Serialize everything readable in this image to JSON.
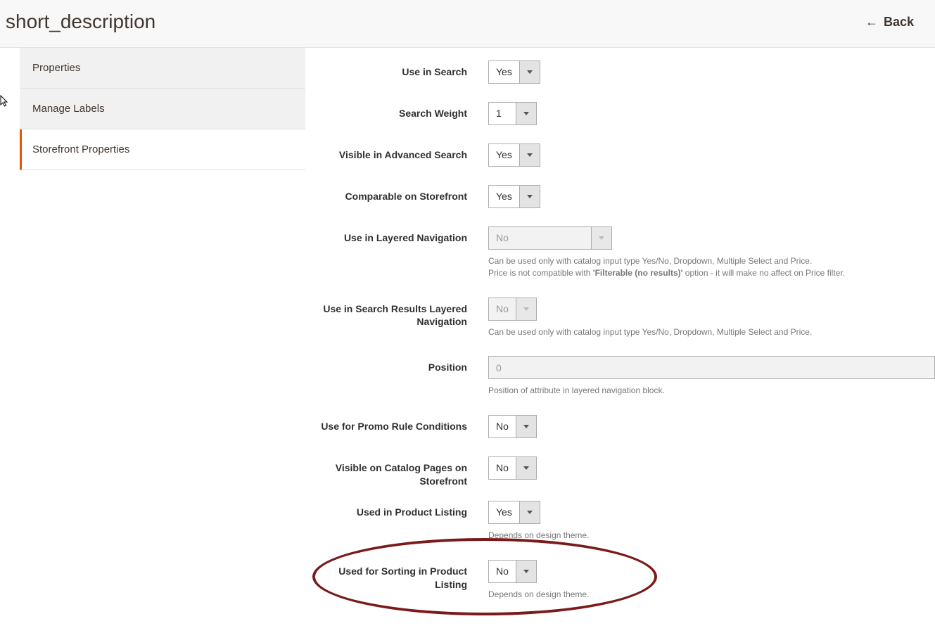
{
  "header": {
    "title": "short_description",
    "back_label": "Back"
  },
  "tabs": {
    "properties": "Properties",
    "manage_labels": "Manage Labels",
    "storefront_properties": "Storefront Properties"
  },
  "fields": {
    "use_in_search": {
      "label": "Use in Search",
      "value": "Yes"
    },
    "search_weight": {
      "label": "Search Weight",
      "value": "1"
    },
    "visible_advanced_search": {
      "label": "Visible in Advanced Search",
      "value": "Yes"
    },
    "comparable_storefront": {
      "label": "Comparable on Storefront",
      "value": "Yes"
    },
    "use_layered_nav": {
      "label": "Use in Layered Navigation",
      "value": "No",
      "hint_pre": "Can be used only with catalog input type Yes/No, Dropdown, Multiple Select and Price.",
      "hint_line2_a": "Price is not compatible with ",
      "hint_line2_b": "'Filterable (no results)'",
      "hint_line2_c": " option - it will make no affect on Price filter."
    },
    "use_search_results_nav": {
      "label": "Use in Search Results Layered Navigation",
      "value": "No",
      "hint": "Can be used only with catalog input type Yes/No, Dropdown, Multiple Select and Price."
    },
    "position": {
      "label": "Position",
      "value": "0",
      "hint": "Position of attribute in layered navigation block."
    },
    "promo_rule": {
      "label": "Use for Promo Rule Conditions",
      "value": "No"
    },
    "visible_catalog": {
      "label": "Visible on Catalog Pages on Storefront",
      "value": "No"
    },
    "used_product_listing": {
      "label": "Used in Product Listing",
      "value": "Yes",
      "hint": "Depends on design theme."
    },
    "used_sorting": {
      "label": "Used for Sorting in Product Listing",
      "value": "No",
      "hint": "Depends on design theme."
    }
  }
}
